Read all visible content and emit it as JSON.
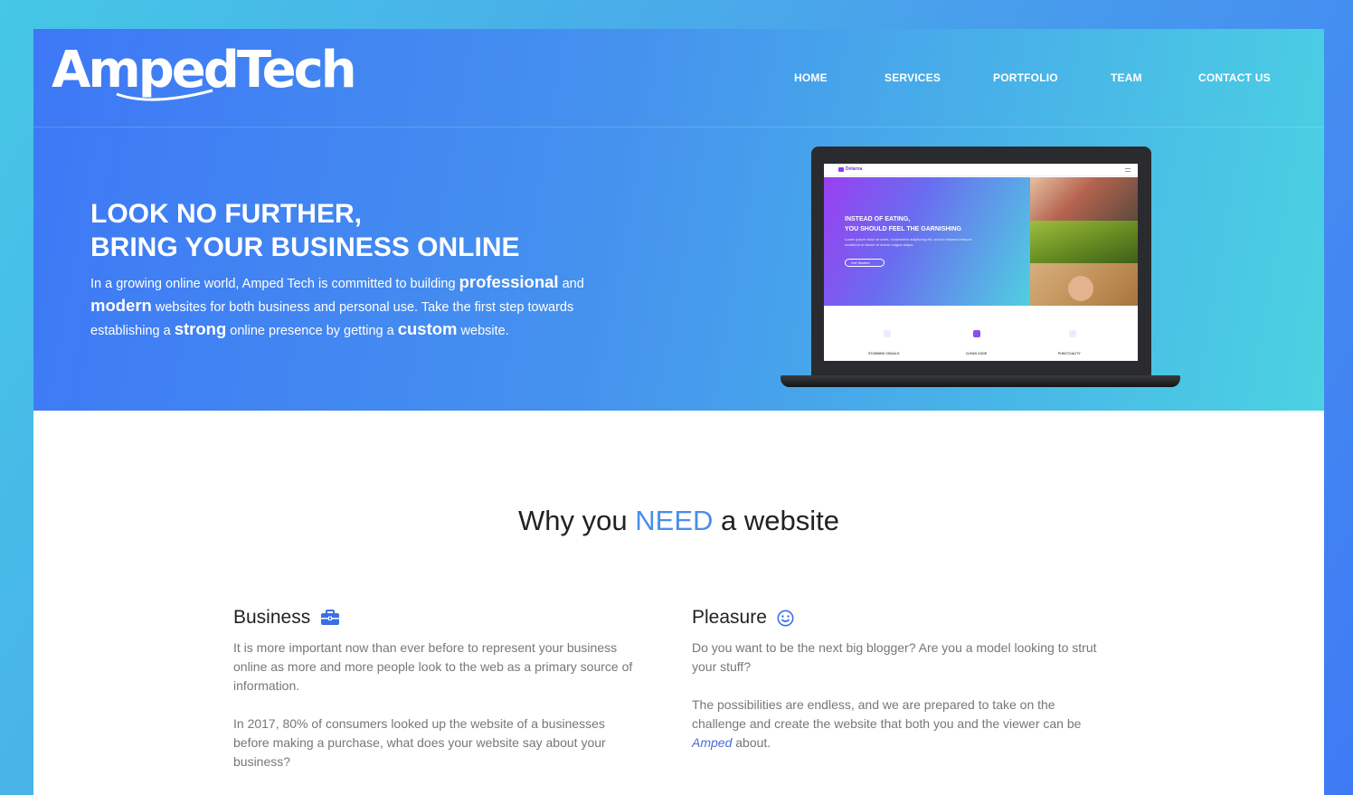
{
  "brand": {
    "logo_text": "AmpedTech"
  },
  "nav": {
    "items": [
      "HOME",
      "SERVICES",
      "PORTFOLIO",
      "TEAM",
      "CONTACT US"
    ]
  },
  "hero": {
    "title_line1": "LOOK NO FURTHER,",
    "title_line2": "BRING YOUR BUSINESS ONLINE",
    "text_part1": "In a growing online world, Amped Tech is committed to building ",
    "text_bold1": "professional",
    "text_part2": " and ",
    "text_bold2": "modern",
    "text_part3": " websites for both business and personal use. Take the first step towards establishing a ",
    "text_bold3": "strong",
    "text_part4": " online presence by getting a ",
    "text_bold4": "custom",
    "text_part5": " website."
  },
  "laptop_screen": {
    "brand": "Delarna",
    "hero_title_line1": "INSTEAD OF EATING,",
    "hero_title_line2": "YOU SHOULD FEEL THE GARNISHING",
    "hero_sub_line1": "Lorem ipsum dolor sit amet, consectetur adipiscing elit, sed do eiusmod tempor",
    "hero_sub_line2": "incididunt ut labore et dolore magna aliqua.",
    "button_label": "Get Started",
    "features": [
      "STUNNING VISUALS",
      "CLEAN CODE",
      "PUNCTUALITY"
    ]
  },
  "why": {
    "title_pre": "Why you ",
    "title_hl": "NEED",
    "title_post": " a website"
  },
  "business": {
    "heading": "Business",
    "icon": "briefcase-icon",
    "p1": "It is more important now than ever before to represent your business online as more and more people look to the web as a primary source of information.",
    "p2": "In 2017, 80% of consumers looked up the website of a businesses before making a purchase, what does your website say about your business?"
  },
  "pleasure": {
    "heading": "Pleasure",
    "icon": "smiley-icon",
    "p1": "Do you want to be the next big blogger? Are you a model looking to strut your stuff?",
    "p2_part1": "The possibilities are endless, and we are prepared to take on the challenge and create the website that both you and the viewer can be ",
    "p2_amped": "Amped",
    "p2_part2": " about."
  },
  "colors": {
    "accent": "#4a8fe8",
    "hero_start": "#3e78f6",
    "hero_end": "#4bd2e2",
    "icon_blue": "#3b6ee8",
    "body_text": "#777777"
  }
}
